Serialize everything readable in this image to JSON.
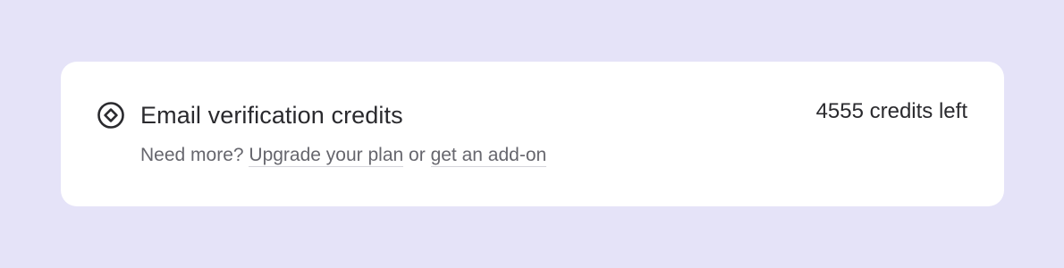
{
  "card": {
    "icon": "credit-diamond-icon",
    "title": "Email verification credits",
    "credits_left": "4555 credits left",
    "prefix": "Need more?",
    "upgrade_link": "Upgrade your plan",
    "connector": "or",
    "addon_link": "get an add-on"
  },
  "colors": {
    "background": "#e5e3f8",
    "card": "#ffffff",
    "text": "#2a2a2e",
    "muted": "#66666d"
  }
}
